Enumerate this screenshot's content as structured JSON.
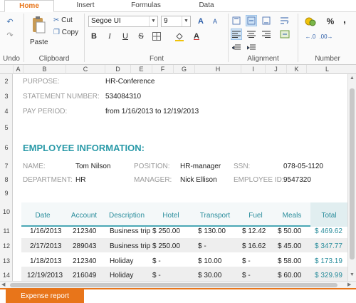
{
  "tabs": [
    "Home",
    "Insert",
    "Formulas",
    "Data"
  ],
  "ribbon": {
    "undo_label": "Undo",
    "clipboard": {
      "paste": "Paste",
      "cut": "Cut",
      "copy": "Copy",
      "group": "Clipboard"
    },
    "font": {
      "family": "Segoe UI",
      "size": "9",
      "group": "Font",
      "bold": "B",
      "italic": "I",
      "underline": "U",
      "strike": "S",
      "grow": "A",
      "shrink": "A"
    },
    "alignment_group": "Alignment",
    "number": {
      "group": "Number",
      "percent": "%",
      "comma": ","
    }
  },
  "columns": [
    "A",
    "B",
    "C",
    "D",
    "E",
    "F",
    "G",
    "H",
    "I",
    "J",
    "K",
    "L"
  ],
  "rows": [
    "2",
    "3",
    "4",
    "5",
    "6",
    "7",
    "8",
    "9",
    "10",
    "11",
    "12",
    "13",
    "14"
  ],
  "info": {
    "purpose_label": "PURPOSE:",
    "purpose": "HR-Conference",
    "statement_label": "STATEMENT NUMBER:",
    "statement": "534084310",
    "period_label": "PAY PERIOD:",
    "period": "from 1/16/2013 to 12/19/2013"
  },
  "employee": {
    "title": "EMPLOYEE INFORMATION:",
    "name_label": "NAME:",
    "name": "Tom Nilson",
    "position_label": "POSITION:",
    "position": "HR-manager",
    "ssn_label": "SSN:",
    "ssn": "078-05-1120",
    "dept_label": "DEPARTMENT:",
    "dept": "HR",
    "manager_label": "MANAGER:",
    "manager": "Nick Ellison",
    "id_label": "EMPLOYEE ID:",
    "id": "9547320"
  },
  "table": {
    "headers": [
      "Date",
      "Account",
      "Description",
      "Hotel",
      "Transport",
      "Fuel",
      "Meals",
      "Total"
    ],
    "rows": [
      [
        "1/16/2013",
        "212340",
        "Business trip",
        "$ 250.00",
        "$ 130.00",
        "$ 12.42",
        "$ 50.00",
        "$ 469.62"
      ],
      [
        "2/17/2013",
        "289043",
        "Business trip",
        "$ 250.00",
        "$ -",
        "$ 16.62",
        "$ 45.00",
        "$ 347.77"
      ],
      [
        "1/18/2013",
        "212340",
        "Holiday",
        "$ -",
        "$ 10.00",
        "$ -",
        "$ 58.00",
        "$ 173.19"
      ],
      [
        "12/19/2013",
        "216049",
        "Holiday",
        "$ -",
        "$ 30.00",
        "$ -",
        "$ 60.00",
        "$ 329.99"
      ]
    ]
  },
  "sheet_tab": "Expense report"
}
